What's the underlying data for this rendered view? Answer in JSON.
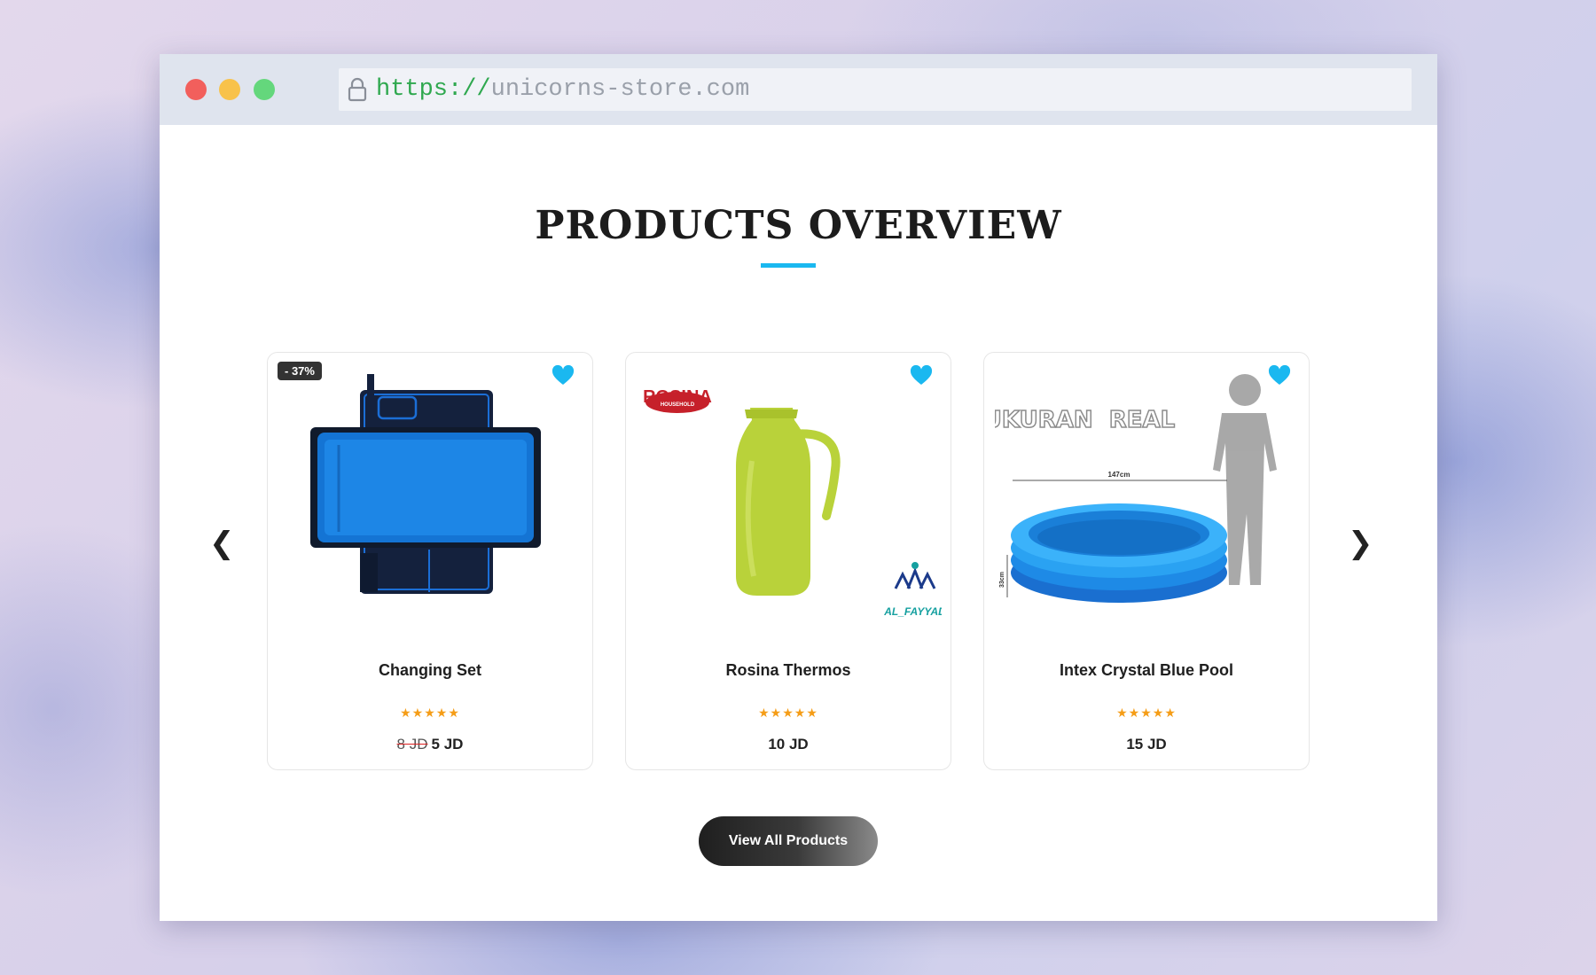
{
  "browser": {
    "url_scheme": "https://",
    "url_host": "unicorns-store.com"
  },
  "section": {
    "title": "PRODUCTS OVERVIEW",
    "accent_color": "#1ab8f0"
  },
  "carousel": {
    "prev_label": "❮",
    "next_label": "❯"
  },
  "products": [
    {
      "name": "Changing Set",
      "badge": "- 37%",
      "rating_stars": "★★★★★",
      "rating": 5,
      "old_price": "8 JD",
      "price": "5 JD"
    },
    {
      "name": "Rosina Thermos",
      "rating_stars": "★★★★★",
      "rating": 5,
      "price": "10 JD",
      "image_brand": "ROSINA",
      "image_brand_sub": "HOUSEHOLD",
      "image_watermark": "AL_FAYYAD"
    },
    {
      "name": "Intex Crystal Blue Pool",
      "rating_stars": "★★★★★",
      "rating": 5,
      "price": "15 JD",
      "image_caption": "UKURAN  REAL",
      "image_width_label": "147cm",
      "image_height_label": "33cm"
    }
  ],
  "actions": {
    "view_all_label": "View All Products"
  },
  "icons": {
    "lock": "lock-icon",
    "heart": "heart-icon",
    "star": "star-icon"
  },
  "colors": {
    "heart": "#1ab8f0",
    "stars": "#f59d17",
    "url_scheme": "#2fa84f"
  }
}
